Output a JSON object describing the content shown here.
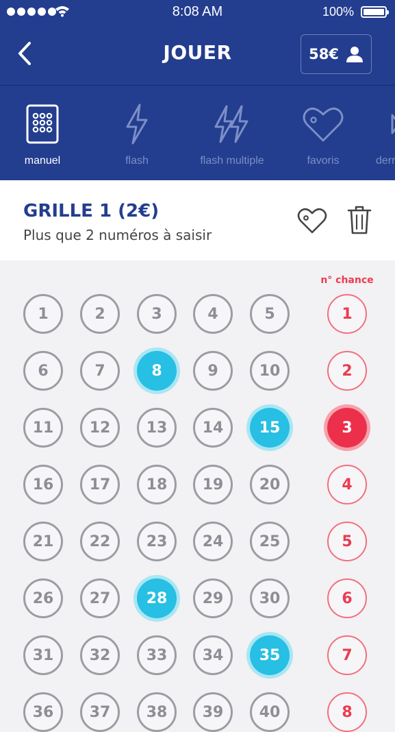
{
  "status_bar": {
    "time": "8:08 AM",
    "battery": "100%"
  },
  "nav": {
    "title": "JOUER",
    "balance": "58€"
  },
  "tabs": [
    {
      "label": "manuel",
      "icon": "grid-keypad-icon",
      "active": true
    },
    {
      "label": "flash",
      "icon": "lightning-icon",
      "active": false
    },
    {
      "label": "flash multiple",
      "icon": "double-lightning-icon",
      "active": false
    },
    {
      "label": "favoris",
      "icon": "heart-icon",
      "active": false
    },
    {
      "label": "derr",
      "icon": "play-icon",
      "active": false
    }
  ],
  "grid": {
    "title": "GRILLE 1 (2€)",
    "subtitle": "Plus que 2 numéros à saisir",
    "chance_label": "n° chance",
    "numbers": [
      [
        "1",
        "2",
        "3",
        "4",
        "5"
      ],
      [
        "6",
        "7",
        "8",
        "9",
        "10"
      ],
      [
        "11",
        "12",
        "13",
        "14",
        "15"
      ],
      [
        "16",
        "17",
        "18",
        "19",
        "20"
      ],
      [
        "21",
        "22",
        "23",
        "24",
        "25"
      ],
      [
        "26",
        "27",
        "28",
        "29",
        "30"
      ],
      [
        "31",
        "32",
        "33",
        "34",
        "35"
      ],
      [
        "36",
        "37",
        "38",
        "39",
        "40"
      ]
    ],
    "selected_numbers": [
      "8",
      "15",
      "28",
      "35"
    ],
    "chance_numbers": [
      "1",
      "2",
      "3",
      "4",
      "5",
      "6",
      "7",
      "8"
    ],
    "selected_chance": "3"
  },
  "colors": {
    "navy": "#233d8f",
    "selected_number": "#27bfe3",
    "chance_red": "#ec3b52"
  }
}
